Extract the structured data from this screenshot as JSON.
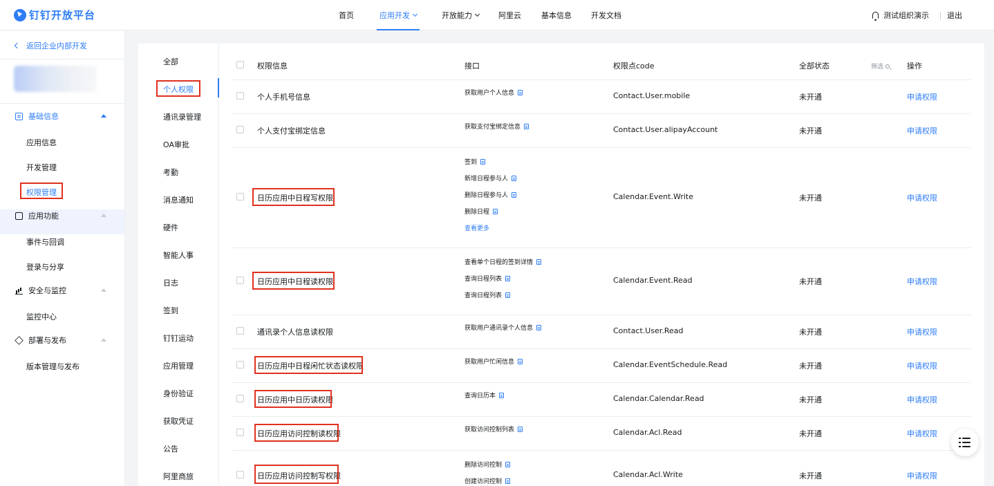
{
  "header": {
    "logo_text": "钉钉开放平台",
    "nav": [
      {
        "label": "首页",
        "active": false,
        "dropdown": false
      },
      {
        "label": "应用开发",
        "active": true,
        "dropdown": true
      },
      {
        "label": "开放能力",
        "active": false,
        "dropdown": true
      },
      {
        "label": "阿里云",
        "active": false,
        "dropdown": false
      },
      {
        "label": "基本信息",
        "active": false,
        "dropdown": false
      },
      {
        "label": "开发文档",
        "active": false,
        "dropdown": false
      }
    ],
    "org_name": "测试组织演示",
    "logout": "退出"
  },
  "sidebar": {
    "back_label": "返回企业内部开发",
    "groups": [
      {
        "label": "基础信息",
        "icon": "document-icon",
        "active": true,
        "items": [
          "应用信息",
          "开发管理",
          "权限管理"
        ]
      },
      {
        "label": "应用功能",
        "icon": "phone-icon",
        "active": false,
        "items": [
          "事件与回调",
          "登录与分享"
        ]
      },
      {
        "label": "安全与监控",
        "icon": "bar-chart-icon",
        "active": false,
        "items": [
          "监控中心"
        ]
      },
      {
        "label": "部署与发布",
        "icon": "cube-icon",
        "active": false,
        "items": [
          "版本管理与发布"
        ]
      }
    ],
    "active_item": "权限管理"
  },
  "categories": [
    "全部",
    "个人权限",
    "通讯录管理",
    "OA审批",
    "考勤",
    "消息通知",
    "硬件",
    "智能人事",
    "日志",
    "签到",
    "钉钉运动",
    "应用管理",
    "身份验证",
    "获取凭证",
    "公告",
    "阿里商旅"
  ],
  "active_category": "个人权限",
  "table": {
    "headers": {
      "info": "权限信息",
      "api": "接口",
      "code": "权限点code",
      "status": "全部状态",
      "filter": "筛选",
      "action": "操作"
    },
    "rows": [
      {
        "name": "个人手机号信息",
        "apis": [
          "获取用户个人信息"
        ],
        "more": "",
        "code": "Contact.User.mobile",
        "status": "未开通",
        "action": "申请权限",
        "highlight": false
      },
      {
        "name": "个人支付宝绑定信息",
        "apis": [
          "获取支付宝绑定信息"
        ],
        "more": "",
        "code": "Contact.User.alipayAccount",
        "status": "未开通",
        "action": "申请权限",
        "highlight": false
      },
      {
        "name": "日历应用中日程写权限",
        "apis": [
          "签到",
          "新增日程参与人",
          "删除日程参与人",
          "删除日程"
        ],
        "more": "查看更多",
        "code": "Calendar.Event.Write",
        "status": "未开通",
        "action": "申请权限",
        "highlight": true
      },
      {
        "name": "日历应用中日程读权限",
        "apis": [
          "查看单个日程的签到详情",
          "查询日程列表",
          "查询日程列表"
        ],
        "more": "",
        "code": "Calendar.Event.Read",
        "status": "未开通",
        "action": "申请权限",
        "highlight": true
      },
      {
        "name": "通讯录个人信息读权限",
        "apis": [
          "获取用户通讯录个人信息"
        ],
        "more": "",
        "code": "Contact.User.Read",
        "status": "未开通",
        "action": "申请权限",
        "highlight": false
      },
      {
        "name": "日历应用中日程闲忙状态读权限",
        "apis": [
          "获取用户忙闲信息"
        ],
        "more": "",
        "code": "Calendar.EventSchedule.Read",
        "status": "未开通",
        "action": "申请权限",
        "highlight": true
      },
      {
        "name": "日历应用中日历读权限",
        "apis": [
          "查询日历本"
        ],
        "more": "",
        "code": "Calendar.Calendar.Read",
        "status": "未开通",
        "action": "申请权限",
        "highlight": true
      },
      {
        "name": "日历应用访问控制读权限",
        "apis": [
          "获取访问控制列表"
        ],
        "more": "",
        "code": "Calendar.Acl.Read",
        "status": "未开通",
        "action": "申请权限",
        "highlight": true
      },
      {
        "name": "日历应用访问控制写权限",
        "apis": [
          "删除访问控制",
          "创建访问控制"
        ],
        "more": "",
        "code": "Calendar.Acl.Write",
        "status": "未开通",
        "action": "申请权限",
        "highlight": true
      }
    ]
  },
  "colors": {
    "accent": "#2d7df6",
    "highlight": "#e0301e",
    "text": "#171a1d",
    "muted": "#8f959e"
  },
  "floating_button": {
    "icon": "list-icon"
  }
}
